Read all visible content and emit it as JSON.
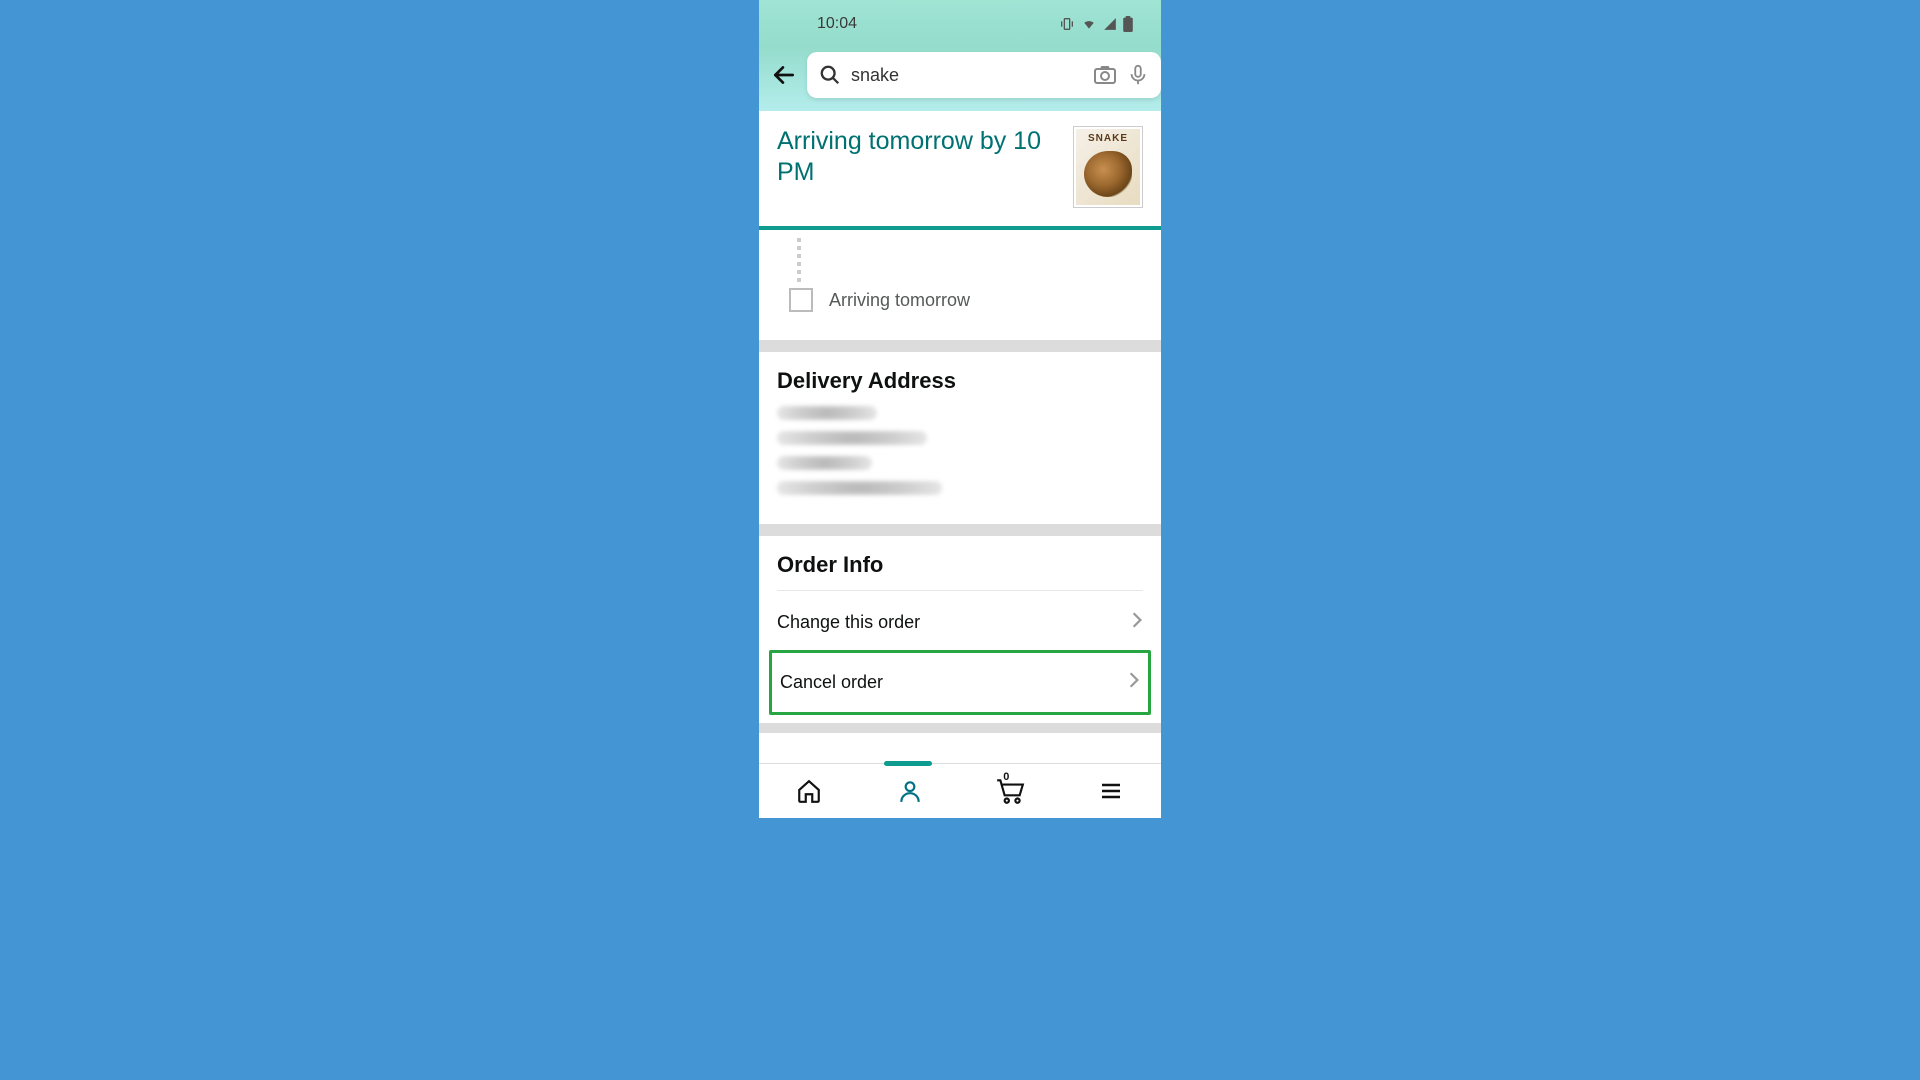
{
  "status": {
    "time": "10:04"
  },
  "search": {
    "value": "snake"
  },
  "arrival": {
    "text": "Arriving tomorrow by 10 PM"
  },
  "product": {
    "thumb_title": "SNAKE"
  },
  "timeline": {
    "item1": "Arriving tomorrow"
  },
  "address": {
    "heading": "Delivery Address"
  },
  "order_info": {
    "heading": "Order Info",
    "change": "Change this order",
    "cancel": "Cancel order"
  },
  "cart": {
    "count": "0"
  }
}
